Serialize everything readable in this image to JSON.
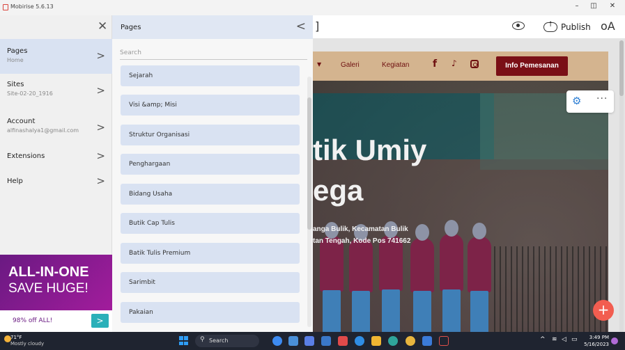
{
  "window": {
    "title": "Mobirise 5.6.13",
    "controls": [
      "–",
      "◫",
      "✕"
    ]
  },
  "topbar": {
    "publish_label": "Publish",
    "icons": [
      "eye-icon",
      "cloud-upload-icon",
      "account-icon"
    ]
  },
  "sidebar": {
    "close_glyph": "✕",
    "items": [
      {
        "label": "Pages",
        "sub": "Home"
      },
      {
        "label": "Sites",
        "sub": "Site-02-20_1916"
      },
      {
        "label": "Account",
        "sub": "alfinashalya1@gmail.com"
      },
      {
        "label": "Extensions",
        "sub": ""
      },
      {
        "label": "Help",
        "sub": ""
      }
    ]
  },
  "ad": {
    "line1": "ALL-IN-ONE",
    "line2": "SAVE HUGE!",
    "offer": "98% off ALL!"
  },
  "pages_panel": {
    "title": "Pages",
    "search_placeholder": "Search",
    "items": [
      "Sejarah",
      "Visi &amp; Misi",
      "Struktur Organisasi",
      "Penghargaan",
      "Bidang Usaha",
      "Butik Cap Tulis",
      "Batik Tulis Premium",
      "Sarimbit",
      "Pakaian"
    ]
  },
  "preview": {
    "nav_links": [
      "Galeri",
      "Kegiatan"
    ],
    "social": [
      "facebook-icon",
      "tiktok-icon",
      "instagram-icon"
    ],
    "cta": "Info Pemesanan",
    "hero_line1": "tik Umiy",
    "hero_line2": "ega",
    "sub_line1": "anga Bulik, Kecamatan Bulik",
    "sub_line2": "tan Tengah, Kode Pos 741662"
  },
  "taskbar": {
    "temp": "71°F",
    "condition": "Mostly cloudy",
    "search": "Search",
    "time": "3:49 PM",
    "date": "5/16/2023"
  },
  "colors": {
    "accent": "#d9e2f2",
    "brand_maroon": "#7a0f16",
    "fab": "#f25d50",
    "ad_purple": "#7b1a8e",
    "ad_teal": "#2bb0b9"
  }
}
